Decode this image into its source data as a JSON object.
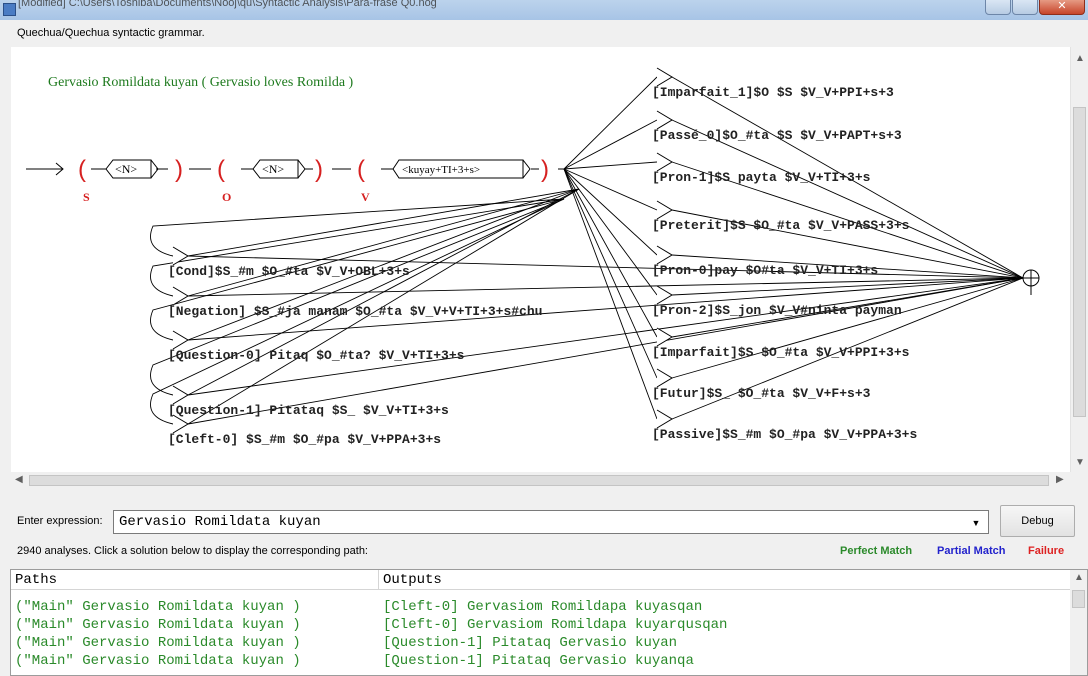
{
  "window": {
    "title": "[Modified] C:\\Users\\Toshiba\\Documents\\Nooj\\qu\\Syntactic Analysis\\Para-frase Q0.nog"
  },
  "subtitle": "Quechua/Quechua syntactic grammar.",
  "graph": {
    "comment": "Gervasio Romildata kuyan ( Gervasio loves Romilda )",
    "open_paren": "(",
    "close_paren": ")",
    "var_s": "S",
    "var_o": "O",
    "var_v": "V",
    "box_n1": "<N>",
    "box_n2": "<N>",
    "box_v": "<kuyay+TI+3+s>",
    "right_outputs": [
      "[Imparfait_1]$O $S $V_V+PPI+s+3",
      "[Passé_0]$O_#ta $S $V_V+PAPT+s+3",
      "[Pron-1]$S payta $V_V+TI+3+s",
      "[Preterit]$S $O_#ta $V_V+PASS+3+s",
      "[Pron-0]pay $O#ta $V_V+TI+3+s",
      "[Pron-2]$S_jon $V_V#ninta payman",
      "[Imparfait]$S $O_#ta $V_V+PPI+3+s",
      "[Futur]$S_ $O_#ta $V_V+F+s+3",
      "[Passive]$S_#m $O_#pa $V_V+PPA+3+s"
    ],
    "left_outputs": [
      "[Cond]$S_#m $O_#ta $V_V+OBL+3+s",
      "[Negation] $S_#ja manam $O_#ta $V_V+V+TI+3+s#chu",
      "[Question-0] Pitaq $O_#ta? $V_V+TI+3+s",
      "[Question-1] Pitataq $S_ $V_V+TI+3+s",
      "[Cleft-0] $S_#m $O_#pa $V_V+PPA+3+s"
    ]
  },
  "expression": {
    "label": "Enter expression:",
    "value": "Gervasio Romildata kuyan"
  },
  "debug_label": "Debug",
  "status_text": "2940 analyses. Click a solution below to display the corresponding path:",
  "legend": [
    {
      "label": "Perfect Match",
      "color": "#2b8a2b"
    },
    {
      "label": "Partial Match",
      "color": "#2222cc"
    },
    {
      "label": "Failure",
      "color": "#dd2222"
    }
  ],
  "results": {
    "headers": [
      "Paths",
      "Outputs"
    ],
    "rows": [
      {
        "path": "(\"Main\" Gervasio Romildata kuyan )",
        "output": "[Cleft-0] Gervasiom Romildapa kuyasqan"
      },
      {
        "path": "(\"Main\" Gervasio Romildata kuyan )",
        "output": "[Cleft-0] Gervasiom Romildapa kuyarqusqan"
      },
      {
        "path": "(\"Main\" Gervasio Romildata kuyan )",
        "output": "[Question-1] Pitataq Gervasio kuyan"
      },
      {
        "path": "(\"Main\" Gervasio Romildata kuyan )",
        "output": "[Question-1] Pitataq Gervasio kuyanqa"
      }
    ]
  }
}
